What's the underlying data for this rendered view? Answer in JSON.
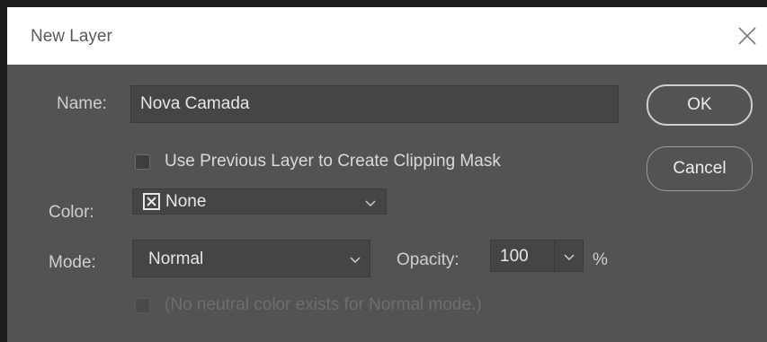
{
  "dialog": {
    "title": "New Layer",
    "name_label": "Name:",
    "name_value": "Nova Camada",
    "clipping_label": "Use Previous Layer to Create Clipping Mask",
    "clipping_checked": false,
    "color_label": "Color:",
    "color_value": "None",
    "color_icon": "x-box-icon",
    "mode_label": "Mode:",
    "mode_value": "Normal",
    "opacity_label": "Opacity:",
    "opacity_value": "100",
    "opacity_unit": "%",
    "neutral_label": "(No neutral color exists for Normal mode.)",
    "neutral_checked": false,
    "ok_label": "OK",
    "cancel_label": "Cancel"
  },
  "colors": {
    "dialog_bg": "#535353",
    "titlebar_bg": "#ffffff",
    "field_bg": "#454545"
  }
}
